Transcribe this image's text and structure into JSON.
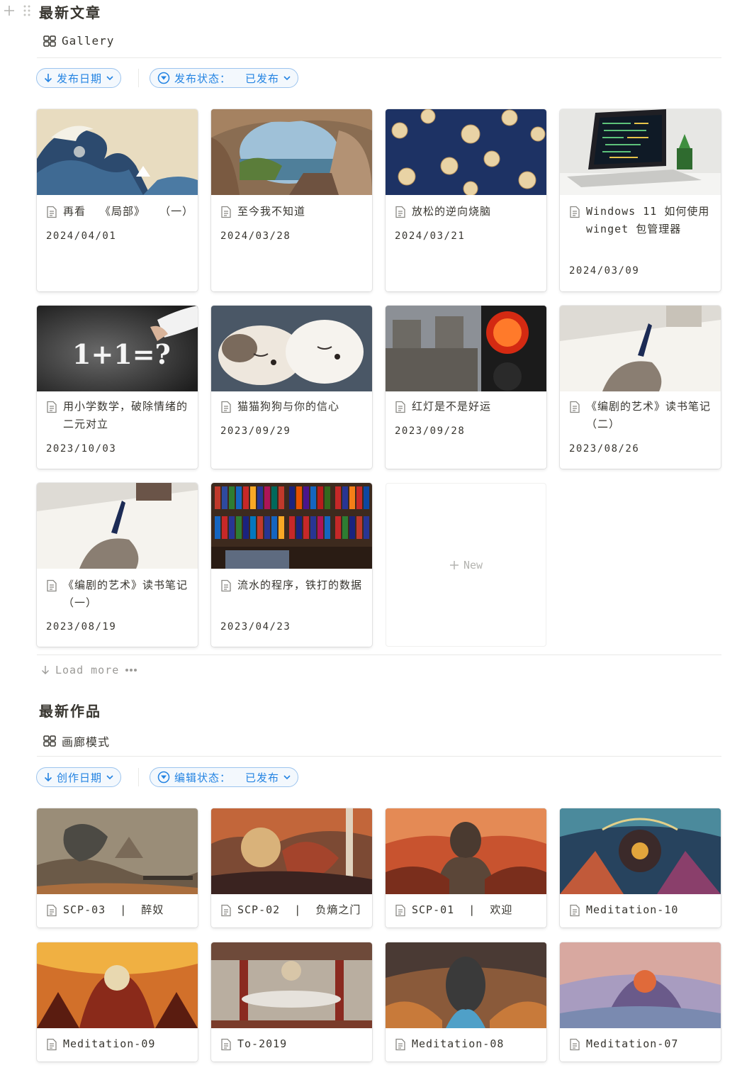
{
  "section1": {
    "title": "最新文章",
    "view_label": "Gallery",
    "sort_label": "发布日期",
    "filter_label": "发布状态：  已发布",
    "new_label": "New",
    "load_more_label": "Load more",
    "cards": [
      {
        "title": "再看  《局部》  （一）",
        "date": "2024/04/01",
        "cover": "great-wave-painting"
      },
      {
        "title": "至今我不知道",
        "date": "2024/03/28",
        "cover": "coastal-rock-arch"
      },
      {
        "title": "放松的逆向烧脑",
        "date": "2024/03/21",
        "cover": "walnuts-on-blue"
      },
      {
        "title": "Windows 11 如何使用 winget 包管理器",
        "date": "2024/03/09",
        "cover": "laptop-code"
      },
      {
        "title": "用小学数学，破除情绪的二元对立",
        "date": "2023/10/03",
        "cover": "chalkboard-math",
        "cover_text": "1+1=?"
      },
      {
        "title": "猫猫狗狗与你的信心",
        "date": "2023/09/29",
        "cover": "sleeping-puppies"
      },
      {
        "title": "红灯是不是好运",
        "date": "2023/09/28",
        "cover": "red-traffic-light"
      },
      {
        "title": "《编剧的艺术》读书笔记  （二）",
        "date": "2023/08/26",
        "cover": "writing-hand"
      },
      {
        "title": "《编剧的艺术》读书笔记  （一）",
        "date": "2023/08/19",
        "cover": "writing-hand"
      },
      {
        "title": "流水的程序，铁打的数据",
        "date": "2023/04/23",
        "cover": "binders-shelf"
      }
    ]
  },
  "section2": {
    "title": "最新作品",
    "view_label": "画廊模式",
    "sort_label": "创作日期",
    "filter_label": "编辑状态：  已发布",
    "cards": [
      {
        "title": "SCP-03  |  醉奴",
        "cover": "scp03-art"
      },
      {
        "title": "SCP-02  |  负熵之门",
        "cover": "scp02-art"
      },
      {
        "title": "SCP-01  |  欢迎",
        "cover": "scp01-art"
      },
      {
        "title": "Meditation-10",
        "cover": "meditation10-art"
      },
      {
        "title": "Meditation-09",
        "cover": "meditation09-art"
      },
      {
        "title": "To-2019",
        "cover": "to2019-art"
      },
      {
        "title": "Meditation-08",
        "cover": "meditation08-art"
      },
      {
        "title": "Meditation-07",
        "cover": "meditation07-art"
      }
    ]
  },
  "icons": {
    "add": "plus-icon",
    "drag": "drag-handle-icon",
    "gallery": "gallery-grid-icon",
    "sort": "arrow-down-icon",
    "filter": "filter-icon",
    "page": "page-icon",
    "load_more": "arrow-down-icon",
    "more": "ellipsis-icon"
  },
  "colors": {
    "accent": "#2383e2",
    "pill_bg": "#f3f8fd",
    "pill_border": "#9cc4ee",
    "text": "#37352f",
    "muted": "#9b9a97"
  }
}
